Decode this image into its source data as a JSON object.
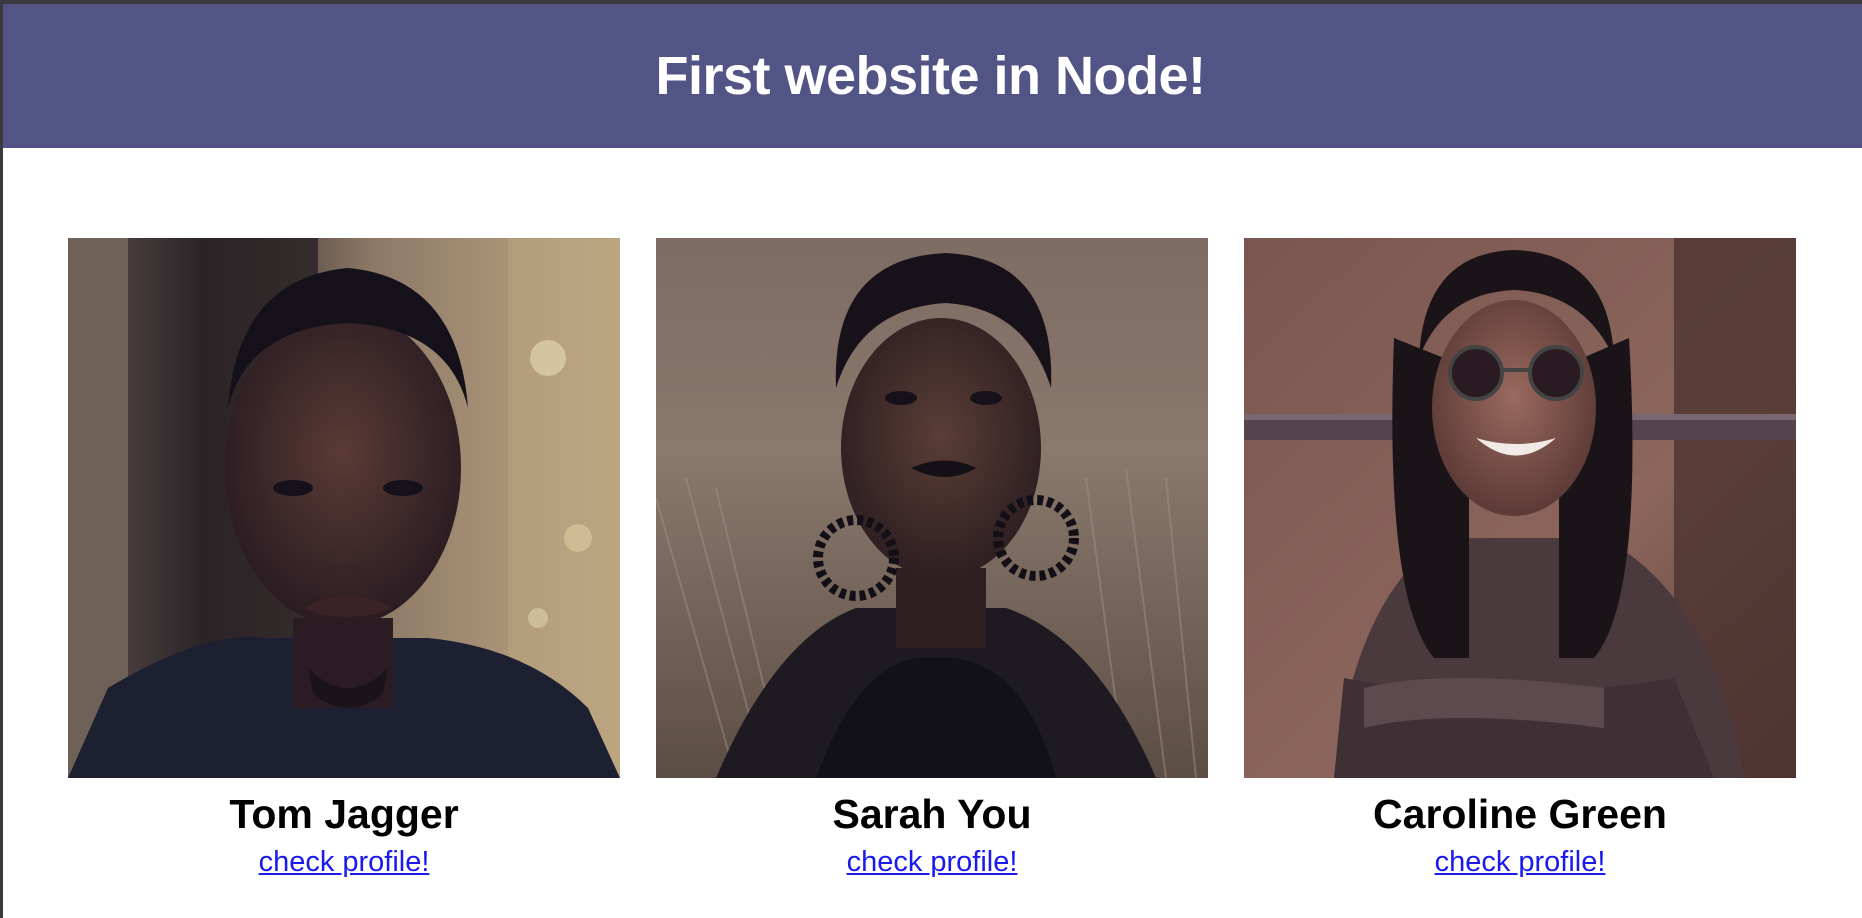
{
  "header": {
    "title": "First website in Node!"
  },
  "profiles": [
    {
      "name": "Tom Jagger",
      "link_label": "check profile!"
    },
    {
      "name": "Sarah You",
      "link_label": "check profile!"
    },
    {
      "name": "Caroline Green",
      "link_label": "check profile!"
    }
  ],
  "colors": {
    "header_background": "#515484",
    "link": "#1a1aee"
  }
}
